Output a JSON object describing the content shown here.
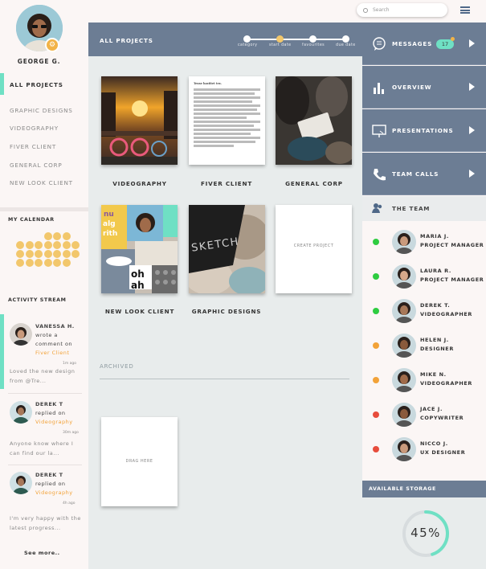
{
  "topbar": {
    "search_placeholder": "Search"
  },
  "user": {
    "name": "GEORGE G."
  },
  "nav": {
    "items": [
      {
        "label": "ALL PROJECTS",
        "active": true
      },
      {
        "label": "GRAPHIC DESIGNS"
      },
      {
        "label": "VIDEOGRAPHY"
      },
      {
        "label": "FIVER CLIENT"
      },
      {
        "label": "GENERAL CORP"
      },
      {
        "label": "NEW LOOK CLIENT"
      }
    ]
  },
  "calendar": {
    "title": "MY CALENDAR",
    "accent": "#f2c76c"
  },
  "activity": {
    "title": "ACTIVITY STREAM",
    "items": [
      {
        "name": "VANESSA H.",
        "action1": "wrote a",
        "action2": "comment on",
        "target": "Fiver Client",
        "time": "1m ago",
        "message": "Loved the new design from @Tre..."
      },
      {
        "name": "DEREK T",
        "action1": "replied on",
        "target": "Videography",
        "time": "30m ago",
        "message": "Anyone know where I can find our la..."
      },
      {
        "name": "DEREK T",
        "action1": "replied on",
        "target": "Videography",
        "time": "4h ago",
        "message": "I'm very happy with the latest progress..."
      }
    ],
    "see_more": "See more.."
  },
  "projects": {
    "title": "ALL PROJECTS",
    "sort_options": [
      "category",
      "start date",
      "favourites",
      "due date"
    ],
    "sort_active_index": 1,
    "cards": [
      {
        "label": "VIDEOGRAPHY"
      },
      {
        "label": "FIVER CLIENT"
      },
      {
        "label": "GENERAL CORP"
      },
      {
        "label": "NEW LOOK CLIENT"
      },
      {
        "label": "GRAPHIC DESIGNS"
      }
    ],
    "create_label": "CREATE PROJECT",
    "archived_title": "ARCHIVED",
    "drag_label": "DRAG HERE",
    "sketch_text": "SKETCH",
    "doc_heading": "Tense hastitet tex.",
    "collage_text_1": "nu",
    "collage_text_2": "alg",
    "collage_text_3": "rith",
    "collage_text_4": "oh",
    "collage_text_5": "ah"
  },
  "right_nav": {
    "items": [
      {
        "label": "MESSAGES",
        "icon": "chat-bubble-icon",
        "badge": "17"
      },
      {
        "label": "OVERVIEW",
        "icon": "bar-chart-icon"
      },
      {
        "label": "PRESENTATIONS",
        "icon": "presentation-screen-icon"
      },
      {
        "label": "TEAM CALLS",
        "icon": "phone-icon"
      }
    ]
  },
  "team": {
    "title": "THE TEAM",
    "members": [
      {
        "name": "MARIA J.",
        "role": "PROJECT MANAGER",
        "status": "#2ecc40"
      },
      {
        "name": "LAURA R.",
        "role": "PROJECT MANAGER",
        "status": "#2ecc40"
      },
      {
        "name": "DEREK T.",
        "role": "VIDEOGRAPHER",
        "status": "#2ecc40"
      },
      {
        "name": "HELEN J.",
        "role": "DESIGNER",
        "status": "#f2a238"
      },
      {
        "name": "MIKE N.",
        "role": "VIDEOGRAPHER",
        "status": "#f2a238"
      },
      {
        "name": "JACE J.",
        "role": "COPYWRITER",
        "status": "#e74c3c"
      },
      {
        "name": "NICCO J.",
        "role": "UX DESIGNER",
        "status": "#e74c3c"
      }
    ]
  },
  "storage": {
    "title": "AVAILABLE STORAGE",
    "percent_label": "45%",
    "percent": 45,
    "accent": "#6fe0c4"
  }
}
